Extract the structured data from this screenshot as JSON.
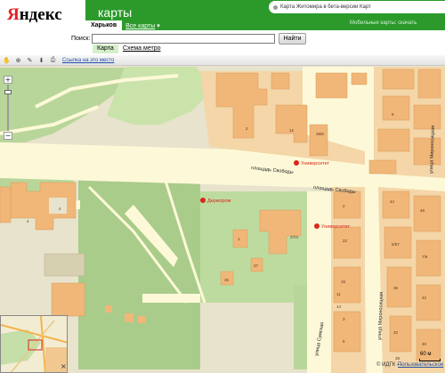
{
  "header": {
    "logo_first": "Я",
    "logo_rest": "ндекс",
    "product": "карты",
    "promo_text": "Карта Житомира в бета-версии Карт",
    "mobile_text": "Мобильные карты:",
    "mobile_link": "скачать",
    "city": "Харьков",
    "all_maps": "Все карты"
  },
  "search": {
    "label": "Поиск:",
    "value": "",
    "button": "Найти"
  },
  "tabs": {
    "map": "Карта",
    "metro": "Схема метро"
  },
  "toolbar": {
    "link": "Ссылка на это место"
  },
  "map": {
    "streets": {
      "square_1": "площадь Свободы",
      "square_2": "площадь Свободы",
      "sumska": "улица Сумская",
      "mironosytska_1": "улица Мироносицкая",
      "mironosytska_2": "улица Мироносицкая"
    },
    "metro": {
      "university_1": "Университет",
      "university_2": "Университет",
      "derzhprom": "Держпром"
    },
    "house_numbers": [
      "2",
      "12",
      "39/8",
      "4",
      "4",
      "37/3",
      "1",
      "37",
      "35",
      "2",
      "22",
      "15",
      "3",
      "5",
      "44",
      "6/57",
      "48",
      "7/9",
      "36",
      "42",
      "11",
      "32",
      "40",
      "38",
      "14",
      "8"
    ]
  },
  "footer": {
    "copyright": "© ИДГК —",
    "terms": "Пользовательское",
    "scale": "60 м",
    "close": "×"
  },
  "colors": {
    "brand_green": "#2b9a2b",
    "building": "#f0b779",
    "park": "#b9d69a",
    "road": "#fdf9d8",
    "ground": "#e8e3cc"
  }
}
